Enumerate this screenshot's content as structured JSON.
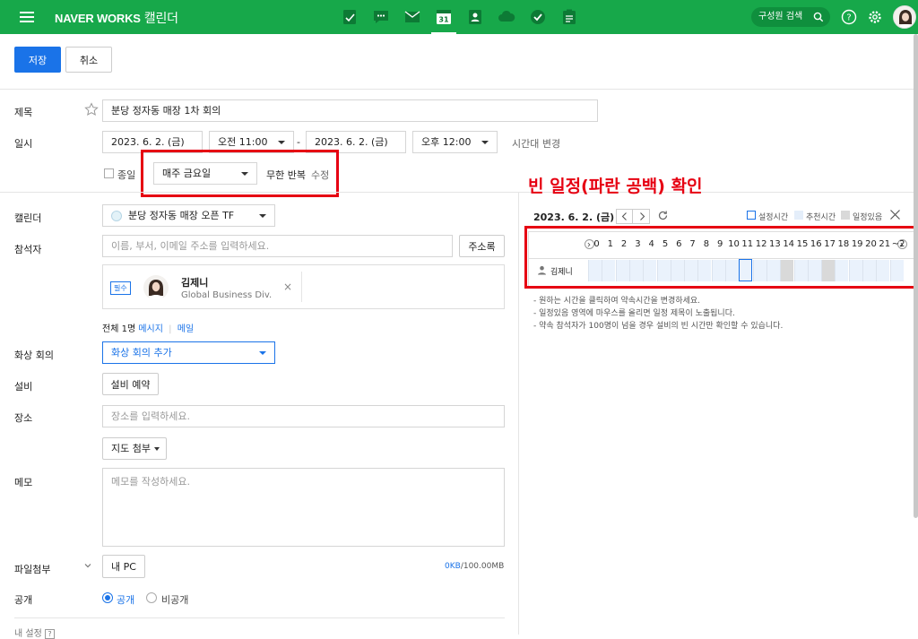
{
  "topbar": {
    "brand": "NAVER WORKS",
    "app_name": "캘린더",
    "calendar_day": "31",
    "search_label": "구성원 검색",
    "colors": {
      "bar": "#17a84a",
      "pill": "#0f8f3d"
    },
    "app_icons": [
      "note-icon",
      "chat-icon",
      "mail-icon",
      "calendar-icon",
      "contacts-icon",
      "drive-icon",
      "task-icon",
      "form-icon"
    ]
  },
  "toolbar": {
    "save_label": "저장",
    "cancel_label": "취소"
  },
  "form": {
    "title_label": "제목",
    "title_value": "분당 정자동 매장 1차 회의",
    "datetime_label": "일시",
    "start_date": "2023. 6. 2. (금)",
    "start_time": "오전 11:00",
    "dash": "-",
    "end_date": "2023. 6. 2. (금)",
    "end_time": "오후 12:00",
    "timezone_link": "시간대 변경",
    "allday_label": "종일",
    "repeat_value": "매주 금요일",
    "repeat_infinite": "무한 반복",
    "repeat_edit": "수정",
    "calendar_label": "캘린더",
    "calendar_value": "분당 정자동 매장 오픈 TF",
    "attendee_label": "참석자",
    "attendee_placeholder": "이름, 부서, 이메일 주소를 입력하세요.",
    "address_book": "주소록",
    "attendee": {
      "badge": "필수",
      "name": "김제니",
      "org": "Global Business Div.",
      "remove": "×"
    },
    "summary_total": "전체 1명",
    "summary_message": "메시지",
    "summary_sep": "|",
    "summary_mail": "메일",
    "video_label": "화상 회의",
    "video_value": "화상 회의 추가",
    "equipment_label": "설비",
    "equipment_button": "설비 예약",
    "place_label": "장소",
    "place_placeholder": "장소를 입력하세요.",
    "map_button": "지도 첨부",
    "memo_label": "메모",
    "memo_placeholder": "메모를 작성하세요.",
    "file_label": "파일첨부",
    "file_button": "내 PC",
    "file_size_used": "0KB",
    "file_size_total": "/100.00MB",
    "public_label": "공개",
    "public_on": "공개",
    "public_off": "비공개",
    "more_settings": "내 설정"
  },
  "annotation": {
    "text": "빈 일정(파란 공백) 확인",
    "color": "#e60012"
  },
  "freebusy": {
    "date": "2023. 6. 2. (금)",
    "legend_set": "설정시간",
    "legend_recommend": "추천시간",
    "legend_busy": "일정있음",
    "hours": [
      "0",
      "1",
      "2",
      "3",
      "4",
      "5",
      "6",
      "7",
      "8",
      "9",
      "10",
      "11",
      "12",
      "13",
      "14",
      "15",
      "16",
      "17",
      "18",
      "19",
      "20",
      "21",
      "~2"
    ],
    "person": "김제니",
    "busy_hours": [
      14,
      17
    ],
    "selected_hour": 11,
    "notes": [
      "- 원하는 시간을 클릭하여 약속시간을 변경하세요.",
      "- 일정있음 영역에 마우스를 올리면 일정 제목이 노출됩니다.",
      "- 약속 참석자가 100명이 넘을 경우 설비의 빈 시간만 확인할 수 있습니다."
    ]
  }
}
